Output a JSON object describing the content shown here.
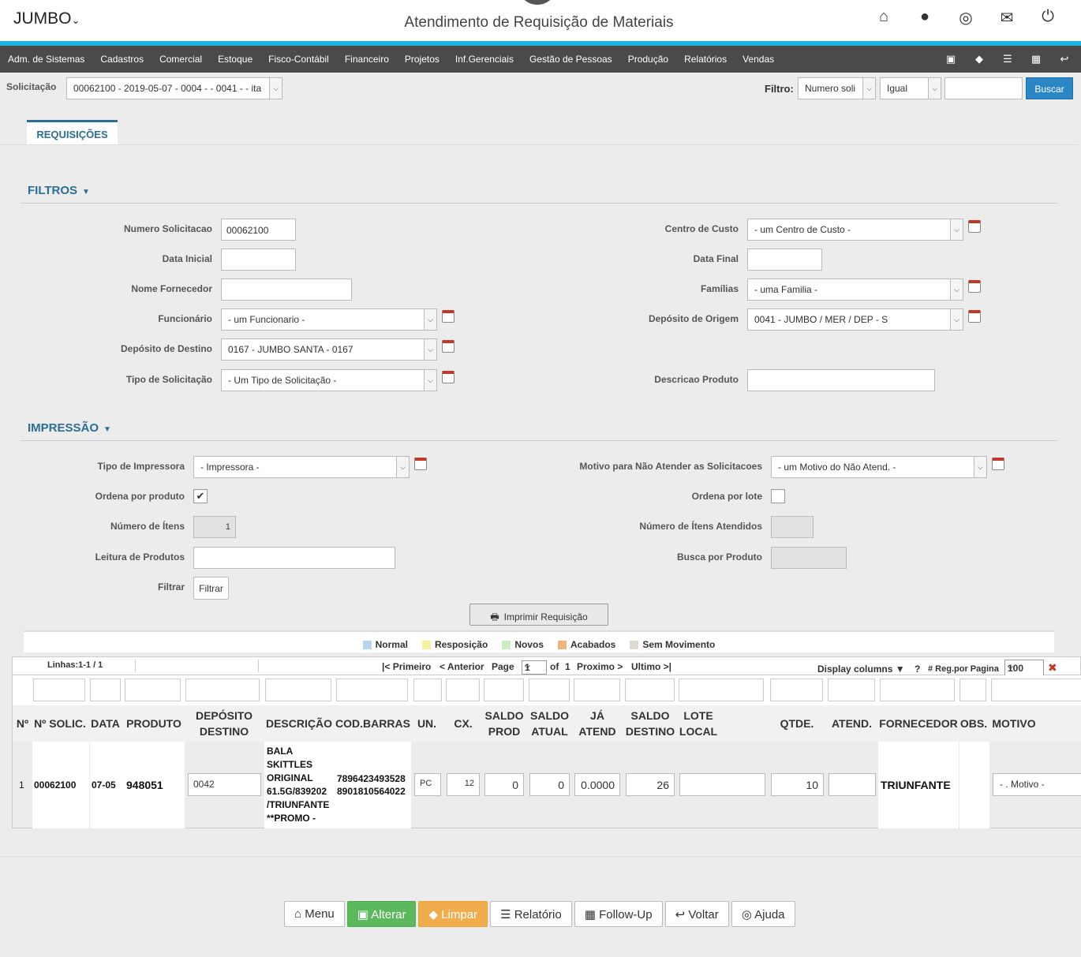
{
  "app": {
    "brand": "JUMBO",
    "title": "Atendimento de Requisição de Materiais"
  },
  "colors": {
    "accent": "#1fb3e6",
    "menu_bg": "#4a4a4a",
    "title_blue": "#2b6e95"
  },
  "top_icons": [
    "home-icon",
    "user-icon",
    "lifebuoy-icon",
    "envelope-icon",
    "power-icon"
  ],
  "menu": {
    "items": [
      "Adm. de Sistemas",
      "Cadastros",
      "Comercial",
      "Estoque",
      "Fisco-Contábil",
      "Financeiro",
      "Projetos",
      "Inf.Gerenciais",
      "Gestão de Pessoas",
      "Produção",
      "Relatórios",
      "Vendas"
    ],
    "icons": [
      "save-icon",
      "eraser-icon",
      "list-icon",
      "table-icon",
      "back-icon"
    ]
  },
  "solicitacao": {
    "label": "Solicitação",
    "value": "00062100 - 2019-05-07 - 0004 - - 0041 - - ita"
  },
  "filtro": {
    "label": "Filtro:",
    "field": "Numero soli",
    "op": "Igual",
    "value": "",
    "button": "Buscar"
  },
  "tab": "REQUISIÇÕES",
  "filtros": {
    "title": "FILTROS",
    "numero_label": "Numero Solicitacao",
    "numero_value": "00062100",
    "data_inicial_label": "Data Inicial",
    "data_inicial_value": "",
    "nome_fornecedor_label": "Nome Fornecedor",
    "nome_fornecedor_value": "",
    "funcionario_label": "Funcionário",
    "funcionario_value": "- um Funcionario -",
    "deposito_destino_label": "Depósito de Destino",
    "deposito_destino_value": "0167 - JUMBO SANTA - 0167",
    "tipo_solicitacao_label": "Tipo de Solicitação",
    "tipo_solicitacao_value": "- Um Tipo de Solicitação -",
    "centro_custo_label": "Centro de Custo",
    "centro_custo_value": "- um Centro de Custo -",
    "data_final_label": "Data Final",
    "data_final_value": "",
    "familias_label": "Famílias",
    "familias_value": "- uma Familia -",
    "deposito_origem_label": "Depósito de Origem",
    "deposito_origem_value": "0041 - JUMBO / MER / DEP - S",
    "descricao_produto_label": "Descricao Produto",
    "descricao_produto_value": ""
  },
  "impressao": {
    "title": "IMPRESSÃO",
    "tipo_impressora_label": "Tipo de Impressora",
    "tipo_impressora_value": "- Impressora -",
    "ordena_produto_label": "Ordena por produto",
    "ordena_produto_check": "✔",
    "numero_itens_label": "Número de Ítens",
    "numero_itens_value": "1",
    "leitura_label": "Leitura de Produtos",
    "leitura_value": "",
    "filtrar_label": "Filtrar",
    "filtrar_button": "Filtrar",
    "motivo_label": "Motivo para Não Atender as Solicitacoes",
    "motivo_value": "- um Motivo do Não Atend. -",
    "ordena_lote_label": "Ordena por lote",
    "itens_atendidos_label": "Número de Ítens Atendidos",
    "itens_atendidos_value": "",
    "busca_produto_label": "Busca por Produto",
    "busca_produto_value": "",
    "print_button": "Imprimir Requisição"
  },
  "legend": [
    {
      "label": "Normal",
      "color": "#b7d4ee"
    },
    {
      "label": "Resposição",
      "color": "#f6f3a0"
    },
    {
      "label": "Novos",
      "color": "#c8efc0"
    },
    {
      "label": "Acabados",
      "color": "#f0b57a"
    },
    {
      "label": "Sem Movimento",
      "color": "#dedbd5"
    }
  ],
  "grid": {
    "lines": "Linhas:1-1 / 1",
    "first": "|< Primeiro",
    "prev": "< Anterior",
    "page_label": "Page",
    "page_value": "1",
    "of": "of",
    "total": "1",
    "next": "Proximo >",
    "last": "Ultimo >|",
    "display_columns": "Display columns ▼",
    "help": "?",
    "reg_label": "# Reg.por Pagina",
    "reg_value": "100",
    "headers": [
      "Nº",
      "Nº SOLIC.",
      "DATA",
      "PRODUTO",
      "DEPÓSITO DESTINO",
      "DESCRIÇÃO",
      "COD.BARRAS",
      "UN.",
      "CX.",
      "SALDO PROD",
      "SALDO ATUAL",
      "JÁ ATEND",
      "SALDO DESTINO",
      "LOTE LOCAL",
      "QTDE.",
      "ATEND.",
      "FORNECEDOR",
      "OBS.",
      "MOTIVO"
    ],
    "row": {
      "n": "1",
      "solic": "00062100",
      "data": "07-05",
      "produto": "948051",
      "deposito": "0042",
      "descricao": "BALA SKITTLES ORIGINAL 61.5G/839202 /TRIUNFANTE **PROMO -",
      "barcode1": "7896423493528",
      "barcode2": "8901810564022",
      "un": "PC",
      "cx": "12",
      "saldo_prod": "0",
      "saldo_atual": "0",
      "ja_atend": "0.0000",
      "saldo_destino": "26",
      "lote_local": "",
      "qtde": "10",
      "atend": "",
      "fornecedor": "TRIUNFANTE",
      "obs": "",
      "motivo": "- . Motivo -"
    }
  },
  "buttons": {
    "menu": "Menu",
    "alterar": "Alterar",
    "limpar": "Limpar",
    "relatorio": "Relatório",
    "followup": "Follow-Up",
    "voltar": "Voltar",
    "ajuda": "Ajuda"
  }
}
